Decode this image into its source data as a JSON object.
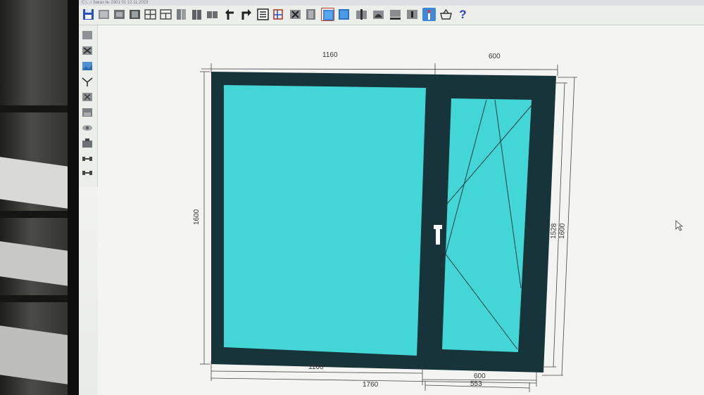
{
  "window": {
    "title": "C:\\...\\ Заказ № 2301 01 12.11.2023"
  },
  "toolbar": {
    "buttons": [
      {
        "name": "save-button",
        "icon": "floppy-disk-icon"
      },
      {
        "name": "tool-frame-button",
        "icon": "frame-icon"
      },
      {
        "name": "tool-sash-button",
        "icon": "sash-icon"
      },
      {
        "name": "tool-glass-button",
        "icon": "glass-icon"
      },
      {
        "name": "tool-grid-button",
        "icon": "grid-icon"
      },
      {
        "name": "tool-split-button",
        "icon": "split-icon"
      },
      {
        "name": "tool-door-button",
        "icon": "door-icon"
      },
      {
        "name": "tool-double-door-button",
        "icon": "double-door-icon"
      },
      {
        "name": "tool-panel-button",
        "icon": "panel-icon"
      },
      {
        "name": "undo-button",
        "icon": "undo-arrow-icon"
      },
      {
        "name": "redo-button",
        "icon": "redo-arrow-icon"
      },
      {
        "name": "properties-button",
        "icon": "list-icon"
      },
      {
        "name": "dimensions-button",
        "icon": "ruler-icon"
      },
      {
        "name": "delete-element-button",
        "icon": "cross-icon"
      },
      {
        "name": "profile-button",
        "icon": "profile-icon"
      },
      {
        "name": "glass-blue-button",
        "icon": "glass-pane-icon"
      },
      {
        "name": "glass-blue-2-button",
        "icon": "glass-pane-icon"
      },
      {
        "name": "mullion-button",
        "icon": "mullion-icon"
      },
      {
        "name": "arch-button",
        "icon": "arch-icon"
      },
      {
        "name": "sill-button",
        "icon": "sill-icon"
      },
      {
        "name": "handle-button",
        "icon": "handle-icon"
      },
      {
        "name": "info-button",
        "icon": "info-icon"
      },
      {
        "name": "basket-button",
        "icon": "basket-icon"
      },
      {
        "name": "help-button",
        "icon": "question-icon",
        "label": "?"
      }
    ]
  },
  "sidebar_tools": [
    {
      "name": "vtool-select",
      "icon": "select-icon"
    },
    {
      "name": "vtool-delete",
      "icon": "cross-icon"
    },
    {
      "name": "vtool-image",
      "icon": "image-icon"
    },
    {
      "name": "vtool-angle",
      "icon": "angle-icon"
    },
    {
      "name": "vtool-cut",
      "icon": "cut-icon"
    },
    {
      "name": "vtool-frame",
      "icon": "frame-icon"
    },
    {
      "name": "vtool-eye",
      "icon": "eye-icon"
    },
    {
      "name": "vtool-weight",
      "icon": "weight-icon"
    },
    {
      "name": "vtool-connect",
      "icon": "connector-icon"
    },
    {
      "name": "vtool-connect-2",
      "icon": "connector-icon"
    }
  ],
  "drawing": {
    "dimensions": {
      "top_left": "1160",
      "top_right": "600",
      "left_height": "1600",
      "right_inner_height": "1528",
      "right_outer_height": "1600",
      "bottom_left": "1160",
      "bottom_right": "600",
      "bottom_total": "1760",
      "bottom_sash": "553"
    },
    "colors": {
      "frame": "#17343a",
      "glass": "#43d6d6",
      "line": "#333333",
      "handle": "#ffffff"
    }
  }
}
